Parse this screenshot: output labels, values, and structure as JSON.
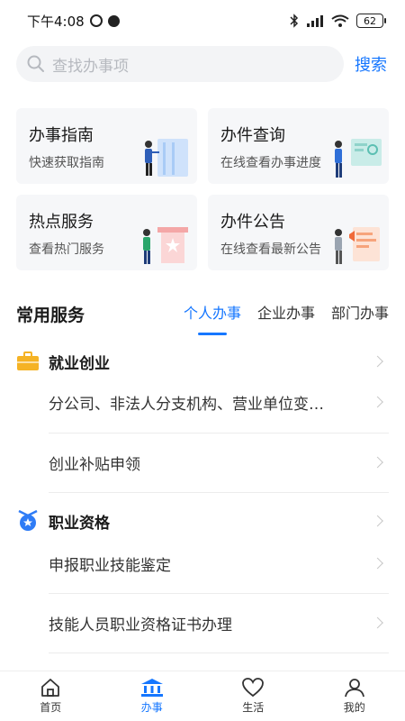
{
  "status_bar": {
    "time": "下午4:08",
    "battery": "62",
    "icons": [
      "alarm-icon",
      "app-notify-icon",
      "bluetooth-icon",
      "signal-icon",
      "wifi-icon",
      "battery-icon"
    ]
  },
  "search": {
    "placeholder": "查找办事项",
    "button_label": "搜索"
  },
  "cards": [
    {
      "title": "办事指南",
      "subtitle": "快速获取指南",
      "icon": "guide-illustration"
    },
    {
      "title": "办件查询",
      "subtitle": "在线查看办事进度",
      "icon": "query-illustration"
    },
    {
      "title": "热点服务",
      "subtitle": "查看热门服务",
      "icon": "hot-service-illustration"
    },
    {
      "title": "办件公告",
      "subtitle": "在线查看最新公告",
      "icon": "announcement-illustration"
    }
  ],
  "common": {
    "title": "常用服务",
    "tabs": [
      {
        "label": "个人办事",
        "active": true
      },
      {
        "label": "企业办事",
        "active": false
      },
      {
        "label": "部门办事",
        "active": false
      }
    ]
  },
  "sections": [
    {
      "label": "就业创业",
      "icon": "briefcase-icon",
      "items": [
        "分公司、非法人分支机构、营业单位变…",
        "创业补贴申领"
      ]
    },
    {
      "label": "职业资格",
      "icon": "medal-icon",
      "items": [
        "申报职业技能鉴定",
        "技能人员职业资格证书办理"
      ]
    }
  ],
  "bottom_nav": [
    {
      "label": "首页",
      "icon": "home-icon",
      "active": false
    },
    {
      "label": "办事",
      "icon": "bank-icon",
      "active": true
    },
    {
      "label": "生活",
      "icon": "heart-icon",
      "active": false
    },
    {
      "label": "我的",
      "icon": "user-icon",
      "active": false
    }
  ],
  "colors": {
    "accent": "#1677ff",
    "card_bg": "#f6f7f9",
    "search_bg": "#f3f4f6",
    "briefcase": "#f5b325",
    "medal": "#2f7cf6"
  }
}
